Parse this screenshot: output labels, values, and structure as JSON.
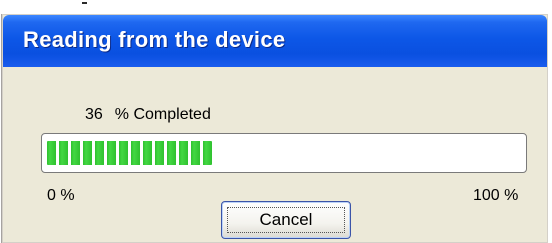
{
  "window": {
    "title": "Reading from the device"
  },
  "progress": {
    "percent_value": "36",
    "completed_label": "% Completed",
    "fraction": 0.36,
    "scale_min_label": "0 %",
    "scale_max_label": "100 %",
    "fill_color": "#2fc12f"
  },
  "buttons": {
    "cancel_label": "Cancel"
  },
  "colors": {
    "titlebar": "#0d57e7",
    "dialog_background": "#ece9d8",
    "title_text": "#ffffff"
  }
}
